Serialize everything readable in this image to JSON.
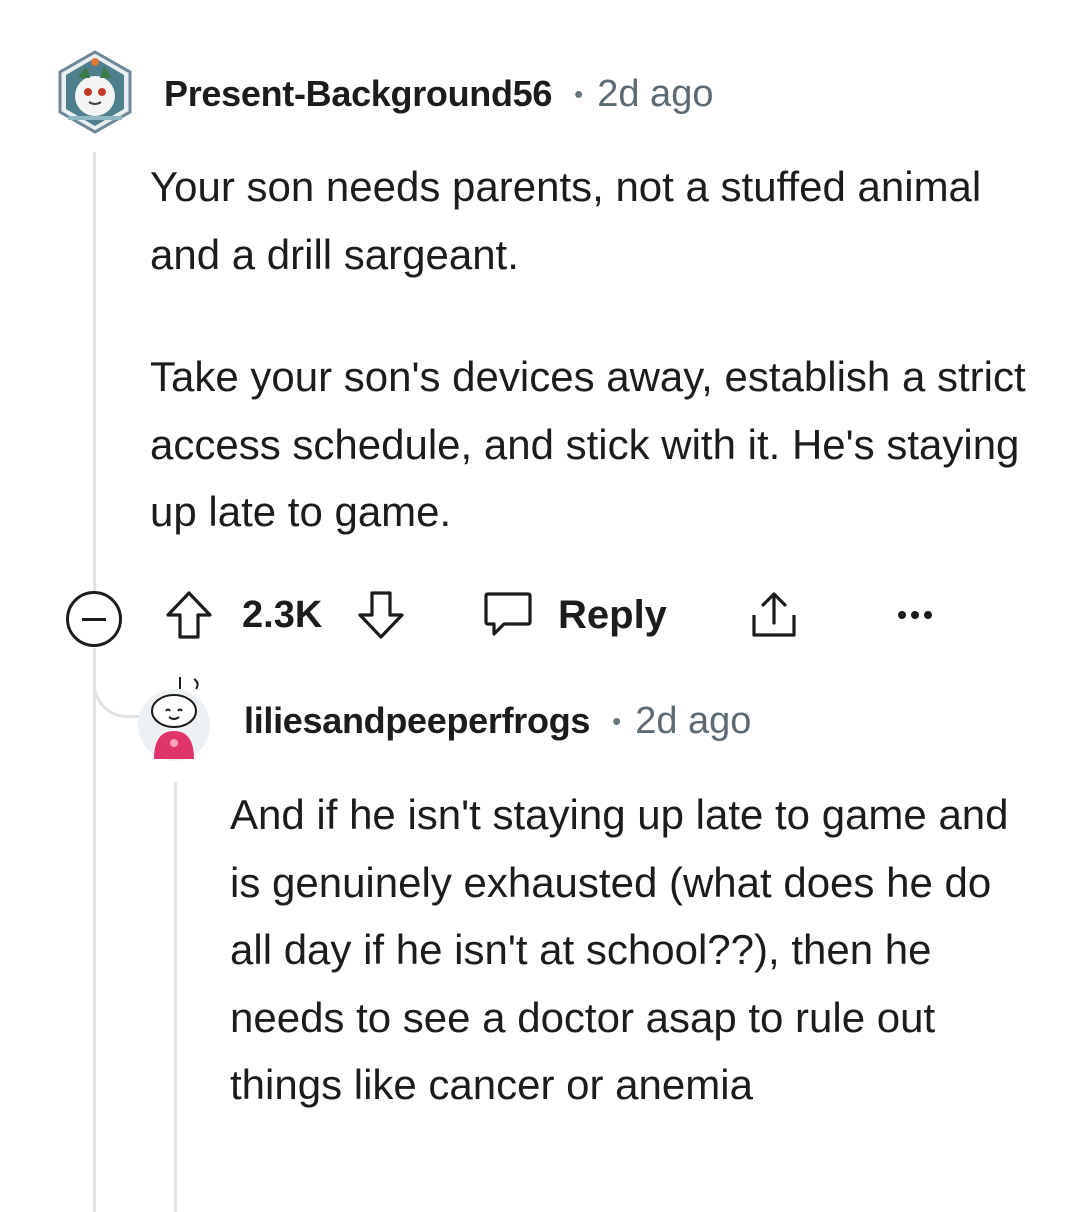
{
  "comment": {
    "username": "Present-Background56",
    "separator": "•",
    "time": "2d ago",
    "paragraphs": [
      "Your son needs parents, not a stuffed animal and a drill sargeant.",
      "Take your son's devices away, establish a strict access schedule, and stick with it. He's staying up late to game."
    ],
    "actions": {
      "score": "2.3K",
      "reply_label": "Reply"
    }
  },
  "reply": {
    "username": "liliesandpeeperfrogs",
    "separator": "•",
    "time": "2d ago",
    "text": "And if he isn't staying up late to game and is genuinely exhausted (what does he do all day if he isn't at school??), then he needs to see a doctor asap to rule out things like cancer or anemia"
  },
  "icons": {
    "collapse": "collapse-minus-icon",
    "upvote": "upvote-arrow-icon",
    "downvote": "downvote-arrow-icon",
    "reply": "speech-bubble-icon",
    "share": "share-icon",
    "more": "more-options-icon"
  },
  "colors": {
    "text": "#1c1c1c",
    "meta": "#5c6a73",
    "thread_line": "#dfe3e6"
  }
}
